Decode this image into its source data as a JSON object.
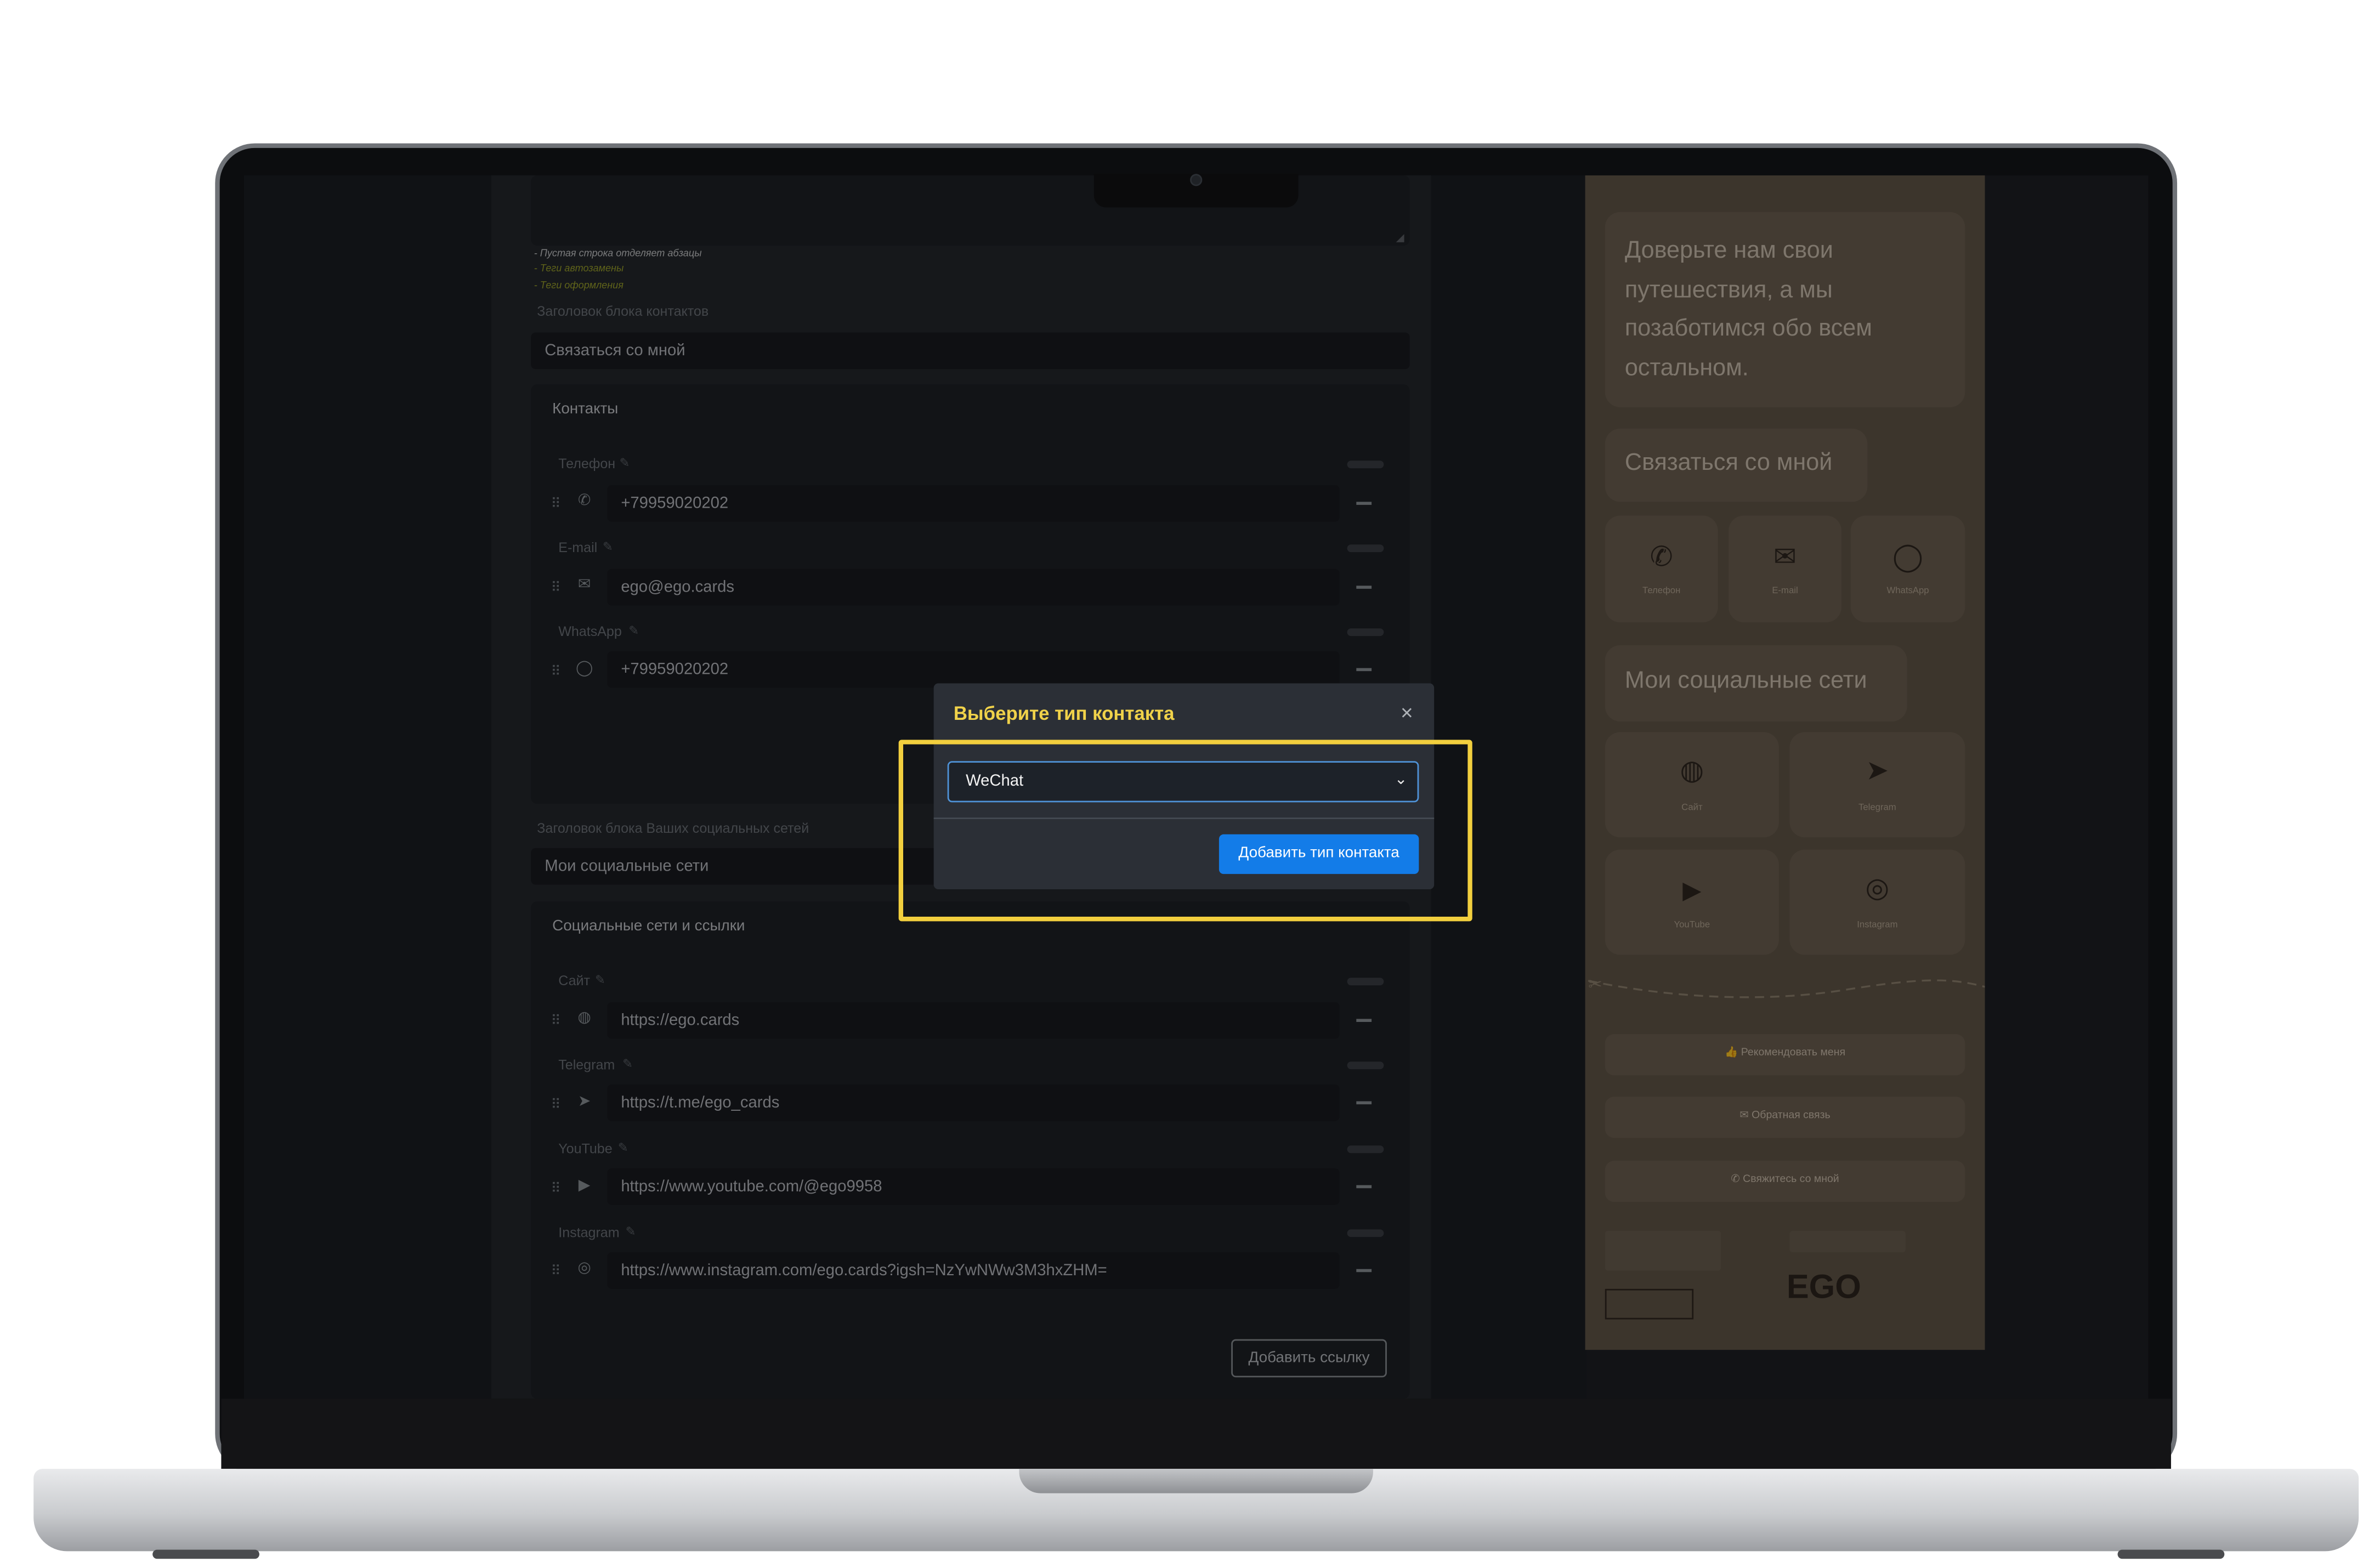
{
  "editor": {
    "hints": [
      "- Пустая строка отделяет абзацы",
      "- Теги автозамены",
      "- Теги оформления"
    ],
    "contacts_heading_label": "Заголовок блока контактов",
    "contacts_heading_value": "Связаться со мной",
    "contacts_panel_title": "Контакты",
    "contacts": [
      {
        "label": "Телефон",
        "icon": "phone-icon",
        "value": "+79959020202"
      },
      {
        "label": "E-mail",
        "icon": "envelope-icon",
        "value": "ego@ego.cards"
      },
      {
        "label": "WhatsApp",
        "icon": "whatsapp-icon",
        "value": "+79959020202"
      }
    ],
    "social_heading_label": "Заголовок блока Ваших социальных сетей",
    "social_heading_value": "Мои социальные сети",
    "social_panel_title": "Социальные сети и ссылки",
    "socials": [
      {
        "label": "Сайт",
        "icon": "globe-icon",
        "value": "https://ego.cards"
      },
      {
        "label": "Telegram",
        "icon": "telegram-icon",
        "value": "https://t.me/ego_cards"
      },
      {
        "label": "YouTube",
        "icon": "youtube-icon",
        "value": "https://www.youtube.com/@ego9958"
      },
      {
        "label": "Instagram",
        "icon": "instagram-icon",
        "value": "https://www.instagram.com/ego.cards?igsh=NzYwNWw3M3hxZHM="
      }
    ],
    "add_link_label": "Добавить ссылку"
  },
  "modal": {
    "title": "Выберите тип контакта",
    "close_glyph": "×",
    "selected_type": "WeChat",
    "add_button_label": "Добавить тип контакта",
    "highlight_color": "#f2cf3e",
    "button_color": "#137ce8"
  },
  "preview": {
    "about_text": "Доверьте нам свои путешествия, а мы позаботимся обо всем остальном.",
    "contacts_heading": "Связаться со мной",
    "contact_tiles": [
      "Телефон",
      "E-mail",
      "WhatsApp"
    ],
    "social_heading": "Мои социальные сети",
    "social_tiles": [
      "Сайт",
      "Telegram",
      "YouTube",
      "Instagram"
    ],
    "actions": [
      "Рекомендовать меня",
      "Обратная связь",
      "Свяжитесь со мной"
    ],
    "brand": "EGO"
  }
}
